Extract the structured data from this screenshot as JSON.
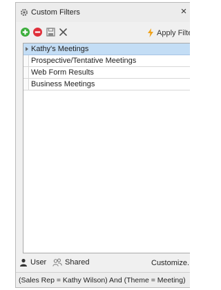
{
  "window": {
    "title": "Custom Filters",
    "close_glyph": "×"
  },
  "toolbar": {
    "add_icon": "add-icon",
    "remove_icon": "remove-icon",
    "save_icon": "save-icon",
    "delete_icon": "delete-icon",
    "apply_label": "Apply Filte",
    "apply_icon": "lightning-icon"
  },
  "filters": [
    {
      "label": "Kathy's Meetings",
      "selected": true
    },
    {
      "label": "Prospective/Tentative Meetings",
      "selected": false
    },
    {
      "label": "Web Form Results",
      "selected": false
    },
    {
      "label": "Business Meetings",
      "selected": false
    }
  ],
  "bottom": {
    "user_label": "User",
    "shared_label": "Shared",
    "customize_label": "Customize..."
  },
  "status": {
    "expression": "(Sales Rep = Kathy Wilson) And (Theme = Meeting)"
  },
  "colors": {
    "add": "#3cae3c",
    "remove": "#e0303b",
    "apply": "#f0a21a",
    "selection": "#c3ddf5"
  }
}
